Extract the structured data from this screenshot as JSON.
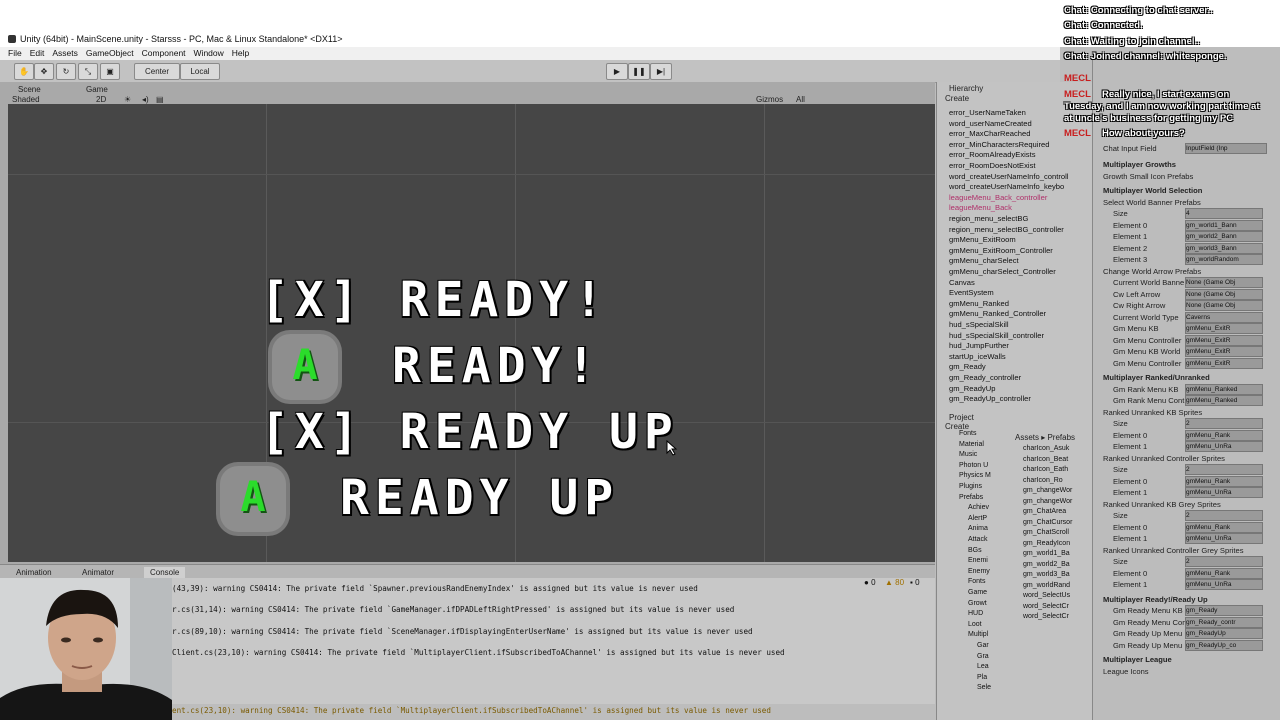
{
  "window": {
    "title": "Unity (64bit) - MainScene.unity - Starsss - PC, Mac & Linux Standalone* <DX11>"
  },
  "menu": [
    "File",
    "Edit",
    "Assets",
    "GameObject",
    "Component",
    "Window",
    "Help"
  ],
  "toolbar": {
    "center": "Center",
    "local": "Local"
  },
  "scene_tabs": {
    "scene": "Scene",
    "game": "Game",
    "shaded": "Shaded",
    "mode2d": "2D",
    "gizmos": "Gizmos",
    "all": "All"
  },
  "scene_text": {
    "row1": "[X] READY!",
    "row2_icon": "A",
    "row2": "READY!",
    "row3": "[X] READY UP",
    "row4_icon": "A",
    "row4": "READY UP"
  },
  "bottom_tabs": {
    "animation": "Animation",
    "animator": "Animator",
    "console": "Console"
  },
  "console_counts": {
    "info": "0",
    "warnings": "80",
    "errors": "0"
  },
  "console_lines": [
    "(43,39): warning CS0414: The private field `Spawner.previousRandEnemyIndex' is assigned but its value is never used",
    "r.cs(31,14): warning CS0414: The private field `GameManager.ifDPADLeftRightPressed' is assigned but its value is never used",
    "r.cs(89,10): warning CS0414: The private field `SceneManager.ifDisplayingEnterUserName' is assigned but its value is never used",
    "Client.cs(23,10): warning CS0414: The private field `MultiplayerClient.ifSubscribedToAChannel' is assigned but its value is never used"
  ],
  "console_last": "ent.cs(23,10): warning CS0414: The private field `MultiplayerClient.ifSubscribedToAChannel' is assigned but its value is never used",
  "hierarchy": {
    "title": "Hierarchy",
    "create": "Create",
    "items": [
      "error_UserNameTaken",
      "word_userNameCreated",
      "error_MaxCharReached",
      "error_MinCharactersRequired",
      "error_RoomAlreadyExists",
      "error_RoomDoesNotExist",
      "word_createUserNameInfo_controll",
      "word_createUserNameInfo_keybo",
      "leagueMenu_Back_controller",
      "leagueMenu_Back",
      "region_menu_selectBG",
      "region_menu_selectBG_controller",
      "gmMenu_ExitRoom",
      "gmMenu_ExitRoom_Controller",
      "gmMenu_charSelect",
      "gmMenu_charSelect_Controller",
      "Canvas",
      "EventSystem",
      "gmMenu_Ranked",
      "gmMenu_Ranked_Controller",
      "hud_sSpecialSkill",
      "hud_sSpecialSkill_controller",
      "hud_JumpFurther",
      "startUp_iceWalls",
      "gm_Ready",
      "gm_Ready_controller",
      "gm_ReadyUp",
      "gm_ReadyUp_controller"
    ]
  },
  "project": {
    "title": "Project",
    "create": "Create",
    "path": "Assets ▸ Prefabs",
    "folders": [
      "Fonts",
      "Material",
      "Music",
      "Photon U",
      "Physics M",
      "Plugins",
      "Prefabs",
      "Achiev",
      "AlertP",
      "Anima",
      "Attack",
      "BGs",
      "Enemi",
      "Enemy",
      "Fonts",
      "Game",
      "Growt",
      "HUD",
      "Loot",
      "Multipl",
      "Gar",
      "Gra",
      "Lea",
      "Pla",
      "Sele"
    ],
    "assets": [
      "charIcon_Asuk",
      "charIcon_Beat",
      "charIcon_Eath",
      "charIcon_Ro",
      "gm_changeWor",
      "gm_changeWor",
      "gm_ChatArea",
      "gm_ChatCursor",
      "gm_ChatScroll",
      "gm_ReadyIcon",
      "gm_world1_Ba",
      "gm_world2_Ba",
      "gm_world3_Ba",
      "gm_worldRand",
      "word_SelectUs",
      "word_SelectCr",
      "word_SelectCr"
    ]
  },
  "inspector": {
    "chat_input_label": "Chat Input Field",
    "chat_input_value": "InputField (Inp",
    "sections": [
      {
        "header": "Multiplayer Growths",
        "rows": [
          [
            "Growth Small Icon Prefabs",
            ""
          ]
        ]
      },
      {
        "header": "Multiplayer World Selection",
        "rows": [
          [
            "Select World Banner Prefabs",
            ""
          ],
          [
            "Size",
            "4"
          ],
          [
            "Element 0",
            "gm_world1_Bann"
          ],
          [
            "Element 1",
            "gm_world2_Bann"
          ],
          [
            "Element 2",
            "gm_world3_Bann"
          ],
          [
            "Element 3",
            "gm_worldRandom"
          ],
          [
            "Change World Arrow Prefabs",
            ""
          ],
          [
            "Current World Banne",
            "None (Game Obj"
          ],
          [
            "Cw Left Arrow",
            "None (Game Obj"
          ],
          [
            "Cw Right Arrow",
            "None (Game Obj"
          ],
          [
            "Current World Type",
            "Caverns"
          ],
          [
            "Gm Menu KB",
            "gmMenu_ExitR"
          ],
          [
            "Gm Menu Controller",
            "gmMenu_ExitR"
          ],
          [
            "Gm Menu KB World",
            "gmMenu_ExitR"
          ],
          [
            "Gm Menu Controller",
            "gmMenu_ExitR"
          ]
        ]
      },
      {
        "header": "Multiplayer Ranked/Unranked",
        "rows": [
          [
            "Gm Rank Menu KB",
            "gmMenu_Ranked"
          ],
          [
            "Gm Rank Menu Cont",
            "gmMenu_Ranked"
          ],
          [
            "Ranked Unranked KB Sprites",
            ""
          ],
          [
            "Size",
            "2"
          ],
          [
            "Element 0",
            "gmMenu_Rank"
          ],
          [
            "Element 1",
            "gmMenu_UnRa"
          ],
          [
            "Ranked Unranked Controller Sprites",
            ""
          ],
          [
            "Size",
            "2"
          ],
          [
            "Element 0",
            "gmMenu_Rank"
          ],
          [
            "Element 1",
            "gmMenu_UnRa"
          ],
          [
            "Ranked Unranked KB Grey Sprites",
            ""
          ],
          [
            "Size",
            "2"
          ],
          [
            "Element 0",
            "gmMenu_Rank"
          ],
          [
            "Element 1",
            "gmMenu_UnRa"
          ],
          [
            "Ranked Unranked Controller Grey Sprites",
            ""
          ],
          [
            "Size",
            "2"
          ],
          [
            "Element 0",
            "gmMenu_Rank"
          ],
          [
            "Element 1",
            "gmMenu_UnRa"
          ]
        ]
      },
      {
        "header": "Multiplayer Ready!/Ready Up",
        "rows": [
          [
            "Gm Ready Menu KB",
            "gm_Ready"
          ],
          [
            "Gm Ready Menu Con",
            "gm_Ready_contr"
          ],
          [
            "Gm Ready Up Menu",
            "gm_ReadyUp"
          ],
          [
            "Gm Ready Up Menu",
            "gm_ReadyUp_co"
          ]
        ]
      },
      {
        "header": "Multiplayer League",
        "rows": [
          [
            "League Icons",
            ""
          ]
        ]
      }
    ]
  },
  "chat": {
    "system": [
      "Chat: Connecting to chat server..",
      "Chat: Connected.",
      "Chat: Waiting to join channel..",
      "Chat: Joined channel: whitesponge."
    ],
    "user": "MECL",
    "messages": [
      "Really nice, I start exams on",
      "Tuesday, and I am now working part time at",
      "at uncle's business for getting my PC",
      "How about yours?"
    ]
  }
}
